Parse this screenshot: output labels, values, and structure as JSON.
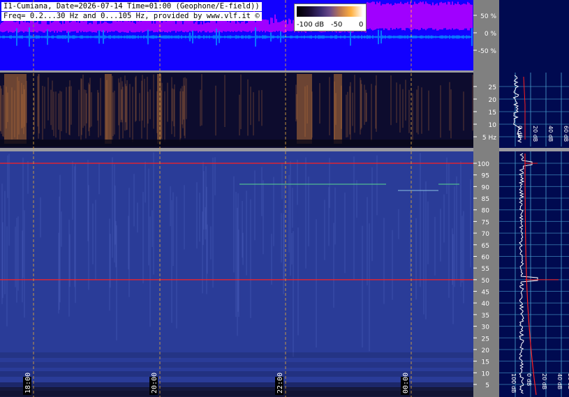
{
  "header": {
    "line1": "I1-Cumiana, Date=2026-07-14 Time=01:00 (Geophone/E-field))",
    "line2": "Freq= 0.2...30 Hz and 0...105 Hz, provided by www.vlf.it ©"
  },
  "colorbar": {
    "labels": [
      "-100 dB",
      "-50",
      "0"
    ]
  },
  "colors": {
    "waveform_bg": "#1200ff",
    "waveform_trace": "#ff00ff",
    "cyan_trace": "#00e8ff",
    "spectrogram_dark": "#0d0c2e",
    "spectrogram_blue": "#2a3c98",
    "axis_panel": "#808080",
    "side_panel": "#000a50",
    "red_line": "#ff2020",
    "time_grid": "#d4a040"
  },
  "chart_data": [
    {
      "type": "line",
      "panel": "amplitude",
      "yticks": [
        "50 %",
        "0 %",
        "-50 %"
      ]
    },
    {
      "type": "heatmap",
      "panel": "spectrogram-low",
      "ylim": [
        0.2,
        30
      ],
      "yticks": [
        "25",
        "20",
        "15",
        "10",
        "5 Hz"
      ]
    },
    {
      "type": "heatmap",
      "panel": "spectrogram-high",
      "ylim": [
        0,
        105
      ],
      "yticks": [
        "100",
        "95",
        "90",
        "85",
        "80",
        "75",
        "70",
        "65",
        "60",
        "55",
        "50",
        "45",
        "40",
        "35",
        "30",
        "25",
        "20",
        "15",
        "10",
        "5"
      ],
      "xticks": [
        "18:00",
        "20:00",
        "22:00",
        "00:00"
      ],
      "red_marker_lines_hz": [
        100,
        50
      ]
    },
    {
      "type": "line",
      "panel": "spectrum-low",
      "xticks": [
        "0 dB",
        "20 dB",
        "40 dB",
        "60 dB"
      ]
    },
    {
      "type": "line",
      "panel": "spectrum-high",
      "xticks": [
        "100 dB",
        "0 dB",
        "20 dB",
        "40 dB",
        "20 dB"
      ]
    }
  ]
}
